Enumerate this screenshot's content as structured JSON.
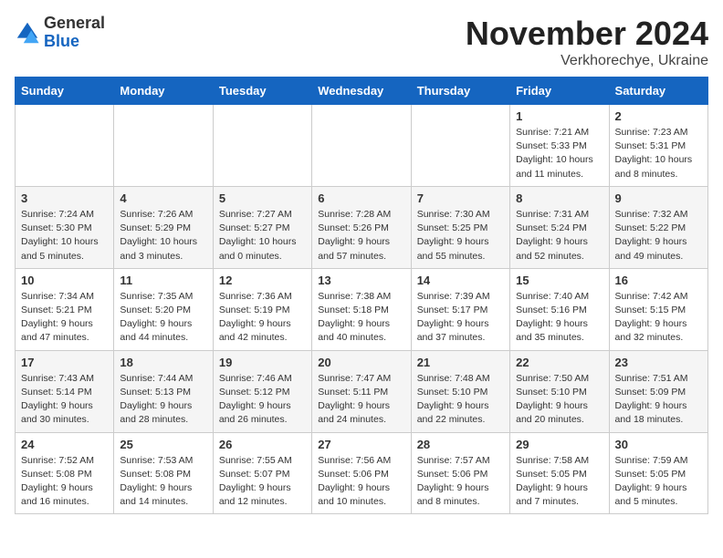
{
  "header": {
    "logo_general": "General",
    "logo_blue": "Blue",
    "month_title": "November 2024",
    "location": "Verkhorechye, Ukraine"
  },
  "weekdays": [
    "Sunday",
    "Monday",
    "Tuesday",
    "Wednesday",
    "Thursday",
    "Friday",
    "Saturday"
  ],
  "weeks": [
    [
      {
        "day": "",
        "content": ""
      },
      {
        "day": "",
        "content": ""
      },
      {
        "day": "",
        "content": ""
      },
      {
        "day": "",
        "content": ""
      },
      {
        "day": "",
        "content": ""
      },
      {
        "day": "1",
        "content": "Sunrise: 7:21 AM\nSunset: 5:33 PM\nDaylight: 10 hours\nand 11 minutes."
      },
      {
        "day": "2",
        "content": "Sunrise: 7:23 AM\nSunset: 5:31 PM\nDaylight: 10 hours\nand 8 minutes."
      }
    ],
    [
      {
        "day": "3",
        "content": "Sunrise: 7:24 AM\nSunset: 5:30 PM\nDaylight: 10 hours\nand 5 minutes."
      },
      {
        "day": "4",
        "content": "Sunrise: 7:26 AM\nSunset: 5:29 PM\nDaylight: 10 hours\nand 3 minutes."
      },
      {
        "day": "5",
        "content": "Sunrise: 7:27 AM\nSunset: 5:27 PM\nDaylight: 10 hours\nand 0 minutes."
      },
      {
        "day": "6",
        "content": "Sunrise: 7:28 AM\nSunset: 5:26 PM\nDaylight: 9 hours\nand 57 minutes."
      },
      {
        "day": "7",
        "content": "Sunrise: 7:30 AM\nSunset: 5:25 PM\nDaylight: 9 hours\nand 55 minutes."
      },
      {
        "day": "8",
        "content": "Sunrise: 7:31 AM\nSunset: 5:24 PM\nDaylight: 9 hours\nand 52 minutes."
      },
      {
        "day": "9",
        "content": "Sunrise: 7:32 AM\nSunset: 5:22 PM\nDaylight: 9 hours\nand 49 minutes."
      }
    ],
    [
      {
        "day": "10",
        "content": "Sunrise: 7:34 AM\nSunset: 5:21 PM\nDaylight: 9 hours\nand 47 minutes."
      },
      {
        "day": "11",
        "content": "Sunrise: 7:35 AM\nSunset: 5:20 PM\nDaylight: 9 hours\nand 44 minutes."
      },
      {
        "day": "12",
        "content": "Sunrise: 7:36 AM\nSunset: 5:19 PM\nDaylight: 9 hours\nand 42 minutes."
      },
      {
        "day": "13",
        "content": "Sunrise: 7:38 AM\nSunset: 5:18 PM\nDaylight: 9 hours\nand 40 minutes."
      },
      {
        "day": "14",
        "content": "Sunrise: 7:39 AM\nSunset: 5:17 PM\nDaylight: 9 hours\nand 37 minutes."
      },
      {
        "day": "15",
        "content": "Sunrise: 7:40 AM\nSunset: 5:16 PM\nDaylight: 9 hours\nand 35 minutes."
      },
      {
        "day": "16",
        "content": "Sunrise: 7:42 AM\nSunset: 5:15 PM\nDaylight: 9 hours\nand 32 minutes."
      }
    ],
    [
      {
        "day": "17",
        "content": "Sunrise: 7:43 AM\nSunset: 5:14 PM\nDaylight: 9 hours\nand 30 minutes."
      },
      {
        "day": "18",
        "content": "Sunrise: 7:44 AM\nSunset: 5:13 PM\nDaylight: 9 hours\nand 28 minutes."
      },
      {
        "day": "19",
        "content": "Sunrise: 7:46 AM\nSunset: 5:12 PM\nDaylight: 9 hours\nand 26 minutes."
      },
      {
        "day": "20",
        "content": "Sunrise: 7:47 AM\nSunset: 5:11 PM\nDaylight: 9 hours\nand 24 minutes."
      },
      {
        "day": "21",
        "content": "Sunrise: 7:48 AM\nSunset: 5:10 PM\nDaylight: 9 hours\nand 22 minutes."
      },
      {
        "day": "22",
        "content": "Sunrise: 7:50 AM\nSunset: 5:10 PM\nDaylight: 9 hours\nand 20 minutes."
      },
      {
        "day": "23",
        "content": "Sunrise: 7:51 AM\nSunset: 5:09 PM\nDaylight: 9 hours\nand 18 minutes."
      }
    ],
    [
      {
        "day": "24",
        "content": "Sunrise: 7:52 AM\nSunset: 5:08 PM\nDaylight: 9 hours\nand 16 minutes."
      },
      {
        "day": "25",
        "content": "Sunrise: 7:53 AM\nSunset: 5:08 PM\nDaylight: 9 hours\nand 14 minutes."
      },
      {
        "day": "26",
        "content": "Sunrise: 7:55 AM\nSunset: 5:07 PM\nDaylight: 9 hours\nand 12 minutes."
      },
      {
        "day": "27",
        "content": "Sunrise: 7:56 AM\nSunset: 5:06 PM\nDaylight: 9 hours\nand 10 minutes."
      },
      {
        "day": "28",
        "content": "Sunrise: 7:57 AM\nSunset: 5:06 PM\nDaylight: 9 hours\nand 8 minutes."
      },
      {
        "day": "29",
        "content": "Sunrise: 7:58 AM\nSunset: 5:05 PM\nDaylight: 9 hours\nand 7 minutes."
      },
      {
        "day": "30",
        "content": "Sunrise: 7:59 AM\nSunset: 5:05 PM\nDaylight: 9 hours\nand 5 minutes."
      }
    ]
  ]
}
